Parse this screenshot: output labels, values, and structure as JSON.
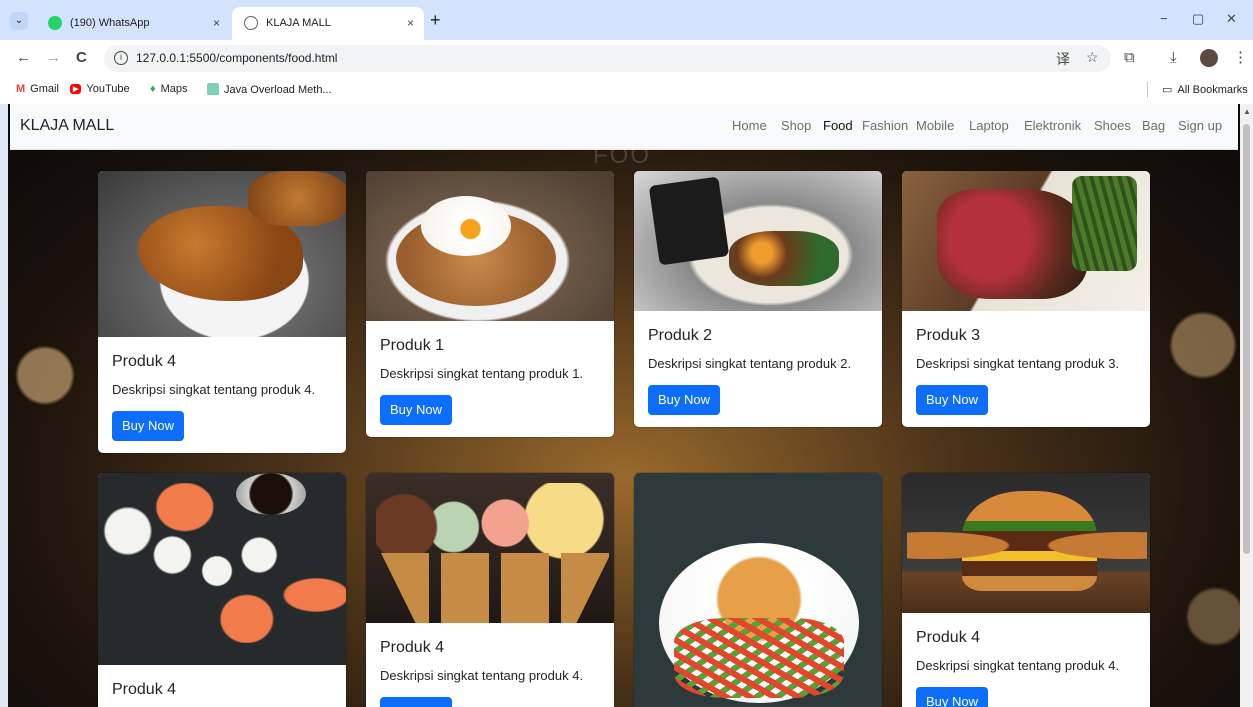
{
  "browser": {
    "tabs": [
      {
        "title": "(190) WhatsApp",
        "icon": "whatsapp-icon"
      },
      {
        "title": "KLAJA MALL",
        "icon": "globe-icon"
      }
    ],
    "url": "127.0.0.1:5500/components/food.html",
    "bookmarks": [
      {
        "label": "Gmail",
        "icon": "gmail-icon"
      },
      {
        "label": "YouTube",
        "icon": "youtube-icon"
      },
      {
        "label": "Maps",
        "icon": "maps-icon"
      },
      {
        "label": "Java Overload Meth...",
        "icon": "bookmark-page-icon"
      }
    ],
    "all_bookmarks_label": "All Bookmarks",
    "icons": {
      "back": "←",
      "forward": "→",
      "reload": "C",
      "close": "×",
      "new_tab": "+",
      "minimize": "−",
      "restore": "▢",
      "win_close": "✕",
      "star": "☆",
      "translate": "译",
      "extensions": "⧉",
      "download": "⤓",
      "menu": "⋮",
      "info": "i"
    }
  },
  "site": {
    "brand": "KLAJA MALL",
    "nav": [
      "Home",
      "Shop",
      "Food",
      "Fashion",
      "Mobile",
      "Laptop",
      "Elektronik",
      "Shoes",
      "Bag",
      "Sign up"
    ],
    "active_nav": "Food",
    "page_heading_partial": "FOO"
  },
  "products": [
    {
      "title": "Produk 4",
      "description": "Deskripsi singkat tentang produk 4.",
      "button": "Buy Now",
      "image": "fried-chicken"
    },
    {
      "title": "Produk 1",
      "description": "Deskripsi singkat tentang produk 1.",
      "button": "Buy Now",
      "image": "fried-rice"
    },
    {
      "title": "Produk 2",
      "description": "Deskripsi singkat tentang produk 2.",
      "button": "Buy Now",
      "image": "ramen"
    },
    {
      "title": "Produk 3",
      "description": "Deskripsi singkat tentang produk 3.",
      "button": "Buy Now",
      "image": "steak"
    },
    {
      "title": "Produk 4",
      "description": "",
      "button": "",
      "image": "sushi"
    },
    {
      "title": "Produk 4",
      "description": "Deskripsi singkat tentang produk 4.",
      "button": "Buy Now",
      "image": "ice-cream"
    },
    {
      "title": "",
      "description": "",
      "button": "",
      "image": "chicken-rice-bowl"
    },
    {
      "title": "Produk 4",
      "description": "Deskripsi singkat tentang produk 4.",
      "button": "Buy Now",
      "image": "burger"
    }
  ],
  "colors": {
    "button": "#0d6efd",
    "navbar_bg": "#f8f9fa",
    "tabbar_bg": "#d3e3fd"
  }
}
